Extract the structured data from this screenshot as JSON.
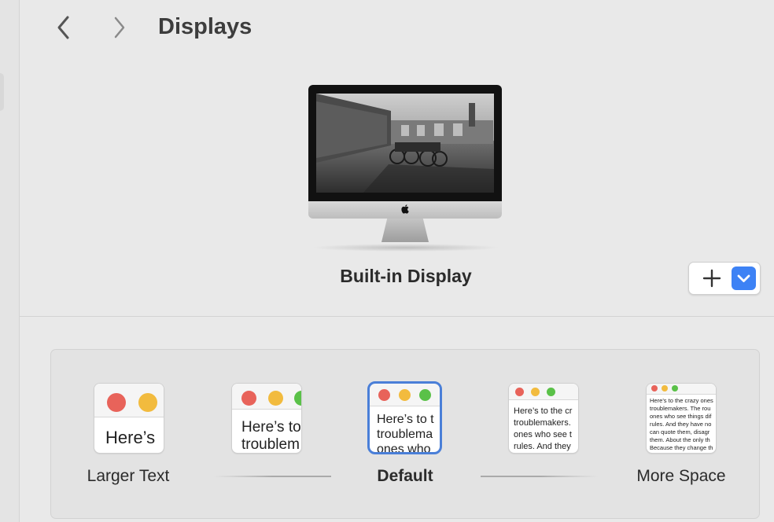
{
  "window": {
    "title": "Displays"
  },
  "toolbar": {
    "back_icon": "chevron-left-icon",
    "forward_icon": "chevron-right-icon"
  },
  "display": {
    "name": "Built-in Display",
    "add_symbol": "+",
    "add_icon": "plus-icon",
    "menu_icon": "chevron-down-icon"
  },
  "resolution": {
    "options": [
      {
        "label": "Larger Text",
        "preview": "Here’s"
      },
      {
        "label": "",
        "preview": "Here’s to\ntroublem"
      },
      {
        "label": "Default",
        "preview": "Here’s to t\ntroublema\nones who"
      },
      {
        "label": "",
        "preview": "Here’s to the cr\ntroublemakers.\nones who see t\nrules. And they"
      },
      {
        "label": "More Space",
        "preview": "Here’s to the crazy ones\ntroublemakers. The rou\nones who see things dif\nrules. And they have no\ncan quote them, disagr\nthem. About the only th\nBecause they change th"
      }
    ],
    "selected": "Default"
  },
  "colors": {
    "accent": "#3d82f5",
    "selection_ring": "#4a7fd8",
    "close": "#e8635a",
    "minimize": "#f2bb3e",
    "zoom": "#5ac148"
  }
}
